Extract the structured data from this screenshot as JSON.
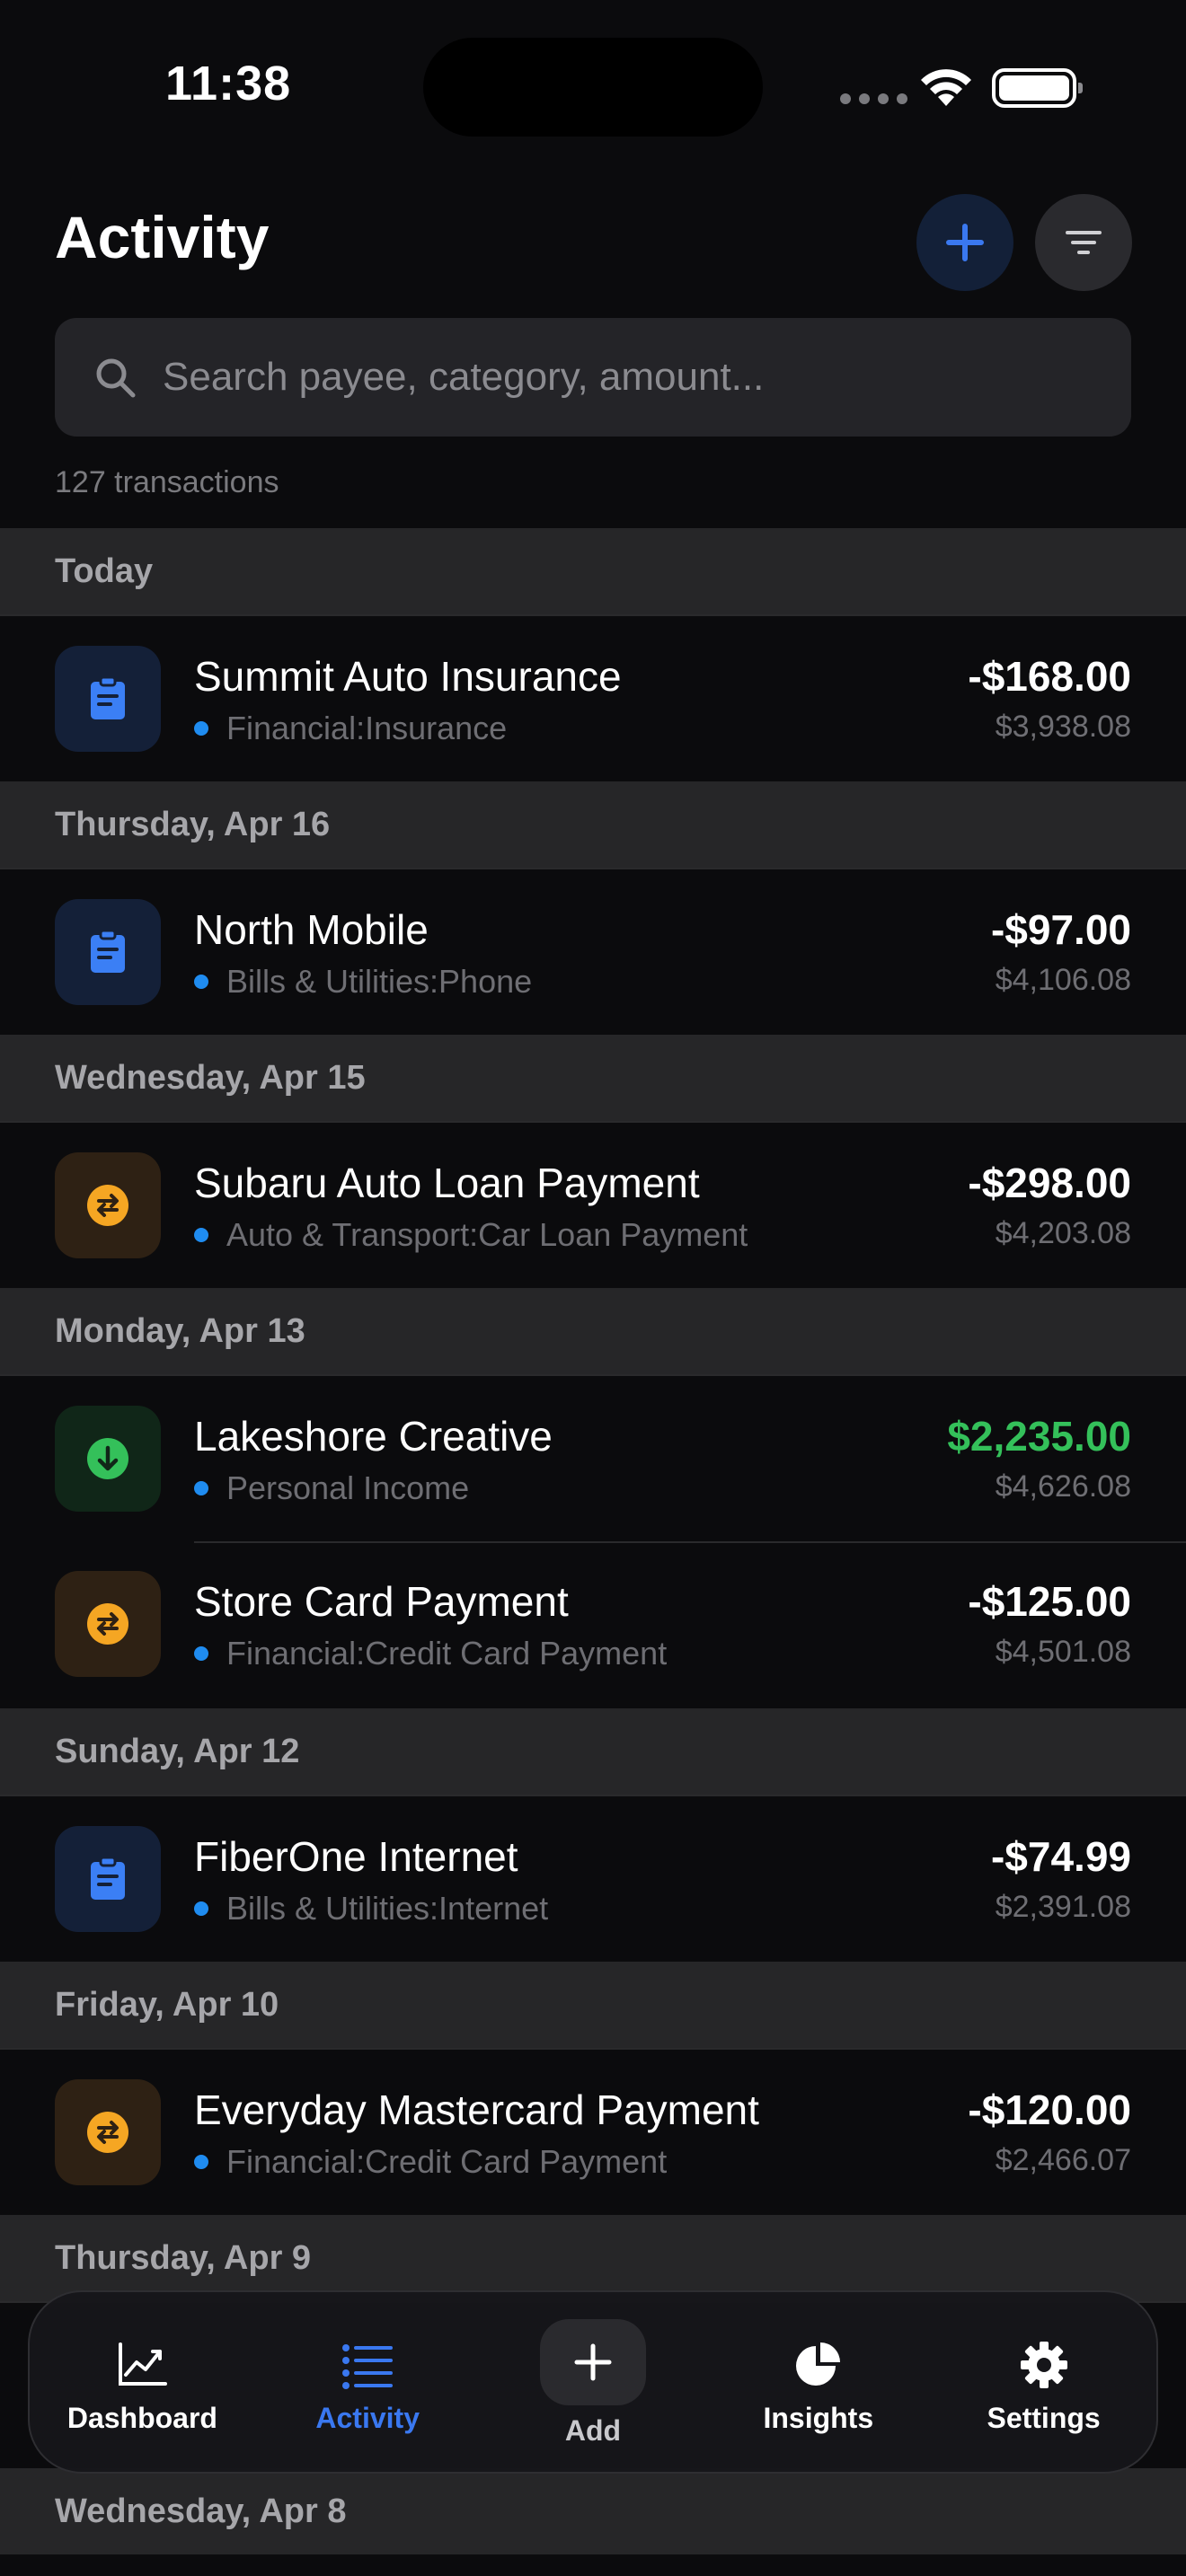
{
  "status_bar": {
    "time": "11:38"
  },
  "header": {
    "title": "Activity"
  },
  "search": {
    "placeholder": "Search payee, category, amount..."
  },
  "summary": {
    "count_text": "127 transactions"
  },
  "sections": [
    {
      "label": "Today"
    },
    {
      "label": "Thursday, Apr 16"
    },
    {
      "label": "Wednesday, Apr 15"
    },
    {
      "label": "Monday, Apr 13"
    },
    {
      "label": "Sunday, Apr 12"
    },
    {
      "label": "Friday, Apr 10"
    },
    {
      "label": "Thursday, Apr 9"
    },
    {
      "label": "Wednesday, Apr 8"
    }
  ],
  "transactions": [
    {
      "name": "Summit Auto Insurance",
      "category": "Financial:Insurance",
      "amount": "-$168.00",
      "balance": "$3,938.08",
      "icon": "bill-icon"
    },
    {
      "name": "North Mobile",
      "category": "Bills & Utilities:Phone",
      "amount": "-$97.00",
      "balance": "$4,106.08",
      "icon": "bill-icon"
    },
    {
      "name": "Subaru Auto Loan Payment",
      "category": "Auto & Transport:Car Loan Payment",
      "amount": "-$298.00",
      "balance": "$4,203.08",
      "icon": "transfer-icon"
    },
    {
      "name": "Lakeshore Creative",
      "category": "Personal Income",
      "amount": "$2,235.00",
      "balance": "$4,626.08",
      "icon": "income-icon"
    },
    {
      "name": "Store Card Payment",
      "category": "Financial:Credit Card Payment",
      "amount": "-$125.00",
      "balance": "$4,501.08",
      "icon": "transfer-icon"
    },
    {
      "name": "FiberOne Internet",
      "category": "Bills & Utilities:Internet",
      "amount": "-$74.99",
      "balance": "$2,391.08",
      "icon": "bill-icon"
    },
    {
      "name": "Everyday Mastercard Payment",
      "category": "Financial:Credit Card Payment",
      "amount": "-$120.00",
      "balance": "$2,466.07",
      "icon": "transfer-icon"
    }
  ],
  "tab_bar": {
    "tabs": [
      {
        "label": "Dashboard",
        "icon": "chart-line-icon"
      },
      {
        "label": "Activity",
        "icon": "list-icon",
        "active": true
      },
      {
        "label": "Add",
        "icon": "plus-icon"
      },
      {
        "label": "Insights",
        "icon": "pie-chart-icon"
      },
      {
        "label": "Settings",
        "icon": "gear-icon"
      }
    ]
  },
  "colors": {
    "accent": "#3a78f0",
    "income": "#34c05a",
    "transfer": "#f5a623",
    "bill": "#3b7ff5",
    "category_dot": "#1f8cf0"
  }
}
